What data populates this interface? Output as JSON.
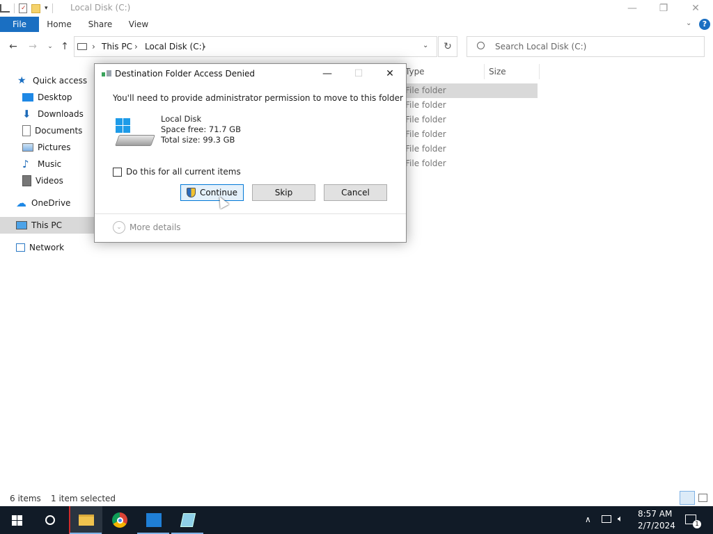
{
  "window": {
    "title": "Local Disk (C:)",
    "minimize_glyph": "—",
    "restore_glyph": "❐",
    "close_glyph": "✕"
  },
  "ribbon": {
    "tabs": [
      "File",
      "Home",
      "Share",
      "View"
    ],
    "help_glyph": "?"
  },
  "address": {
    "crumbs": [
      "This PC",
      "Local Disk (C:)"
    ],
    "search_placeholder": "Search Local Disk (C:)"
  },
  "nav_pane": {
    "items": [
      {
        "label": "Quick access",
        "icon": "star-icon"
      },
      {
        "label": "Desktop",
        "icon": "desktop-icon"
      },
      {
        "label": "Downloads",
        "icon": "download-icon"
      },
      {
        "label": "Documents",
        "icon": "documents-icon"
      },
      {
        "label": "Pictures",
        "icon": "pictures-icon"
      },
      {
        "label": "Music",
        "icon": "music-icon"
      },
      {
        "label": "Videos",
        "icon": "videos-icon"
      },
      {
        "label": "OneDrive",
        "icon": "cloud-icon"
      },
      {
        "label": "This PC",
        "icon": "computer-icon"
      },
      {
        "label": "Network",
        "icon": "network-icon"
      }
    ]
  },
  "file_list": {
    "columns": [
      "Type",
      "Size"
    ],
    "rows": [
      "File folder",
      "File folder",
      "File folder",
      "File folder",
      "File folder",
      "File folder"
    ]
  },
  "status": {
    "item_count": "6 items",
    "selection": "1 item selected"
  },
  "dialog": {
    "title": "Destination Folder Access Denied",
    "message": "You'll need to provide administrator permission to move to this folder",
    "disk_name": "Local Disk",
    "space_free": "Space free: 71.7 GB",
    "total_size": "Total size: 99.3 GB",
    "checkbox_label": "Do this for all current items",
    "continue_label": "Continue",
    "skip_label": "Skip",
    "cancel_label": "Cancel",
    "more_details": "More details"
  },
  "taskbar": {
    "time": "8:57 AM",
    "date": "2/7/2024"
  },
  "colors": {
    "accent": "#1a6fc2",
    "taskbar": "#111b27",
    "selected": "#d9d9d9"
  }
}
